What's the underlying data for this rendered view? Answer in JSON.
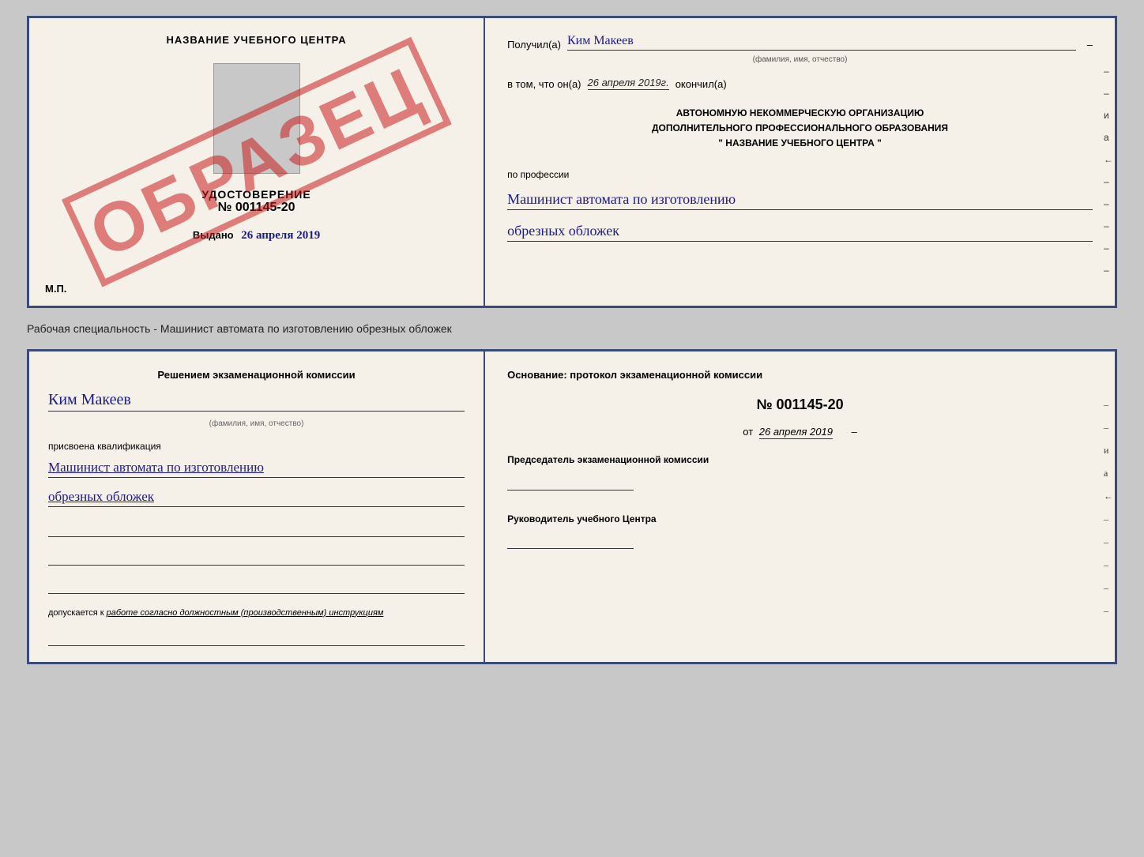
{
  "top_cert": {
    "left": {
      "title": "НАЗВАНИЕ УЧЕБНОГО ЦЕНТРА",
      "doc_label": "УДОСТОВЕРЕНИЕ",
      "doc_number": "№ 001145-20",
      "issued_label": "Выдано",
      "issued_date": "26 апреля 2019",
      "mp_label": "М.П.",
      "stamp_text": "ОБРАЗЕЦ"
    },
    "right": {
      "received_label": "Получил(а)",
      "recipient_name": "Ким Макеев",
      "name_hint": "(фамилия, имя, отчество)",
      "date_prefix": "в том, что он(а)",
      "date_value": "26 апреля 2019г.",
      "finished_label": "окончил(а)",
      "org_line1": "АВТОНОМНУЮ НЕКОММЕРЧЕСКУЮ ОРГАНИЗАЦИЮ",
      "org_line2": "ДОПОЛНИТЕЛЬНОГО ПРОФЕССИОНАЛЬНОГО ОБРАЗОВАНИЯ",
      "org_line3": "\"    НАЗВАНИЕ УЧЕБНОГО ЦЕНТРА    \"",
      "profession_label": "по профессии",
      "profession_line1": "Машинист автомата по изготовлению",
      "profession_line2": "обрезных обложек",
      "side_marks": [
        "–",
        "–",
        "и",
        "а",
        "←",
        "–",
        "–",
        "–",
        "–",
        "–"
      ]
    }
  },
  "caption": {
    "text": "Рабочая специальность - Машинист автомата по изготовлению обрезных обложек"
  },
  "bottom_cert": {
    "left": {
      "commission_title": "Решением экзаменационной комиссии",
      "person_name": "Ким Макеев",
      "name_hint": "(фамилия, имя, отчество)",
      "qualification_label": "присвоена квалификация",
      "qualification_line1": "Машинист автомата по изготовлению",
      "qualification_line2": "обрезных обложек",
      "admission_prefix": "допускается к",
      "admission_text": "работе согласно должностным (производственным) инструкциям"
    },
    "right": {
      "basis_label": "Основание: протокол экзаменационной комиссии",
      "protocol_number": "№  001145-20",
      "date_prefix": "от",
      "date_value": "26 апреля 2019",
      "chairman_label": "Председатель экзаменационной комиссии",
      "director_label": "Руководитель учебного Центра",
      "side_marks": [
        "–",
        "–",
        "и",
        "а",
        "←",
        "–",
        "–",
        "–",
        "–",
        "–"
      ]
    }
  }
}
